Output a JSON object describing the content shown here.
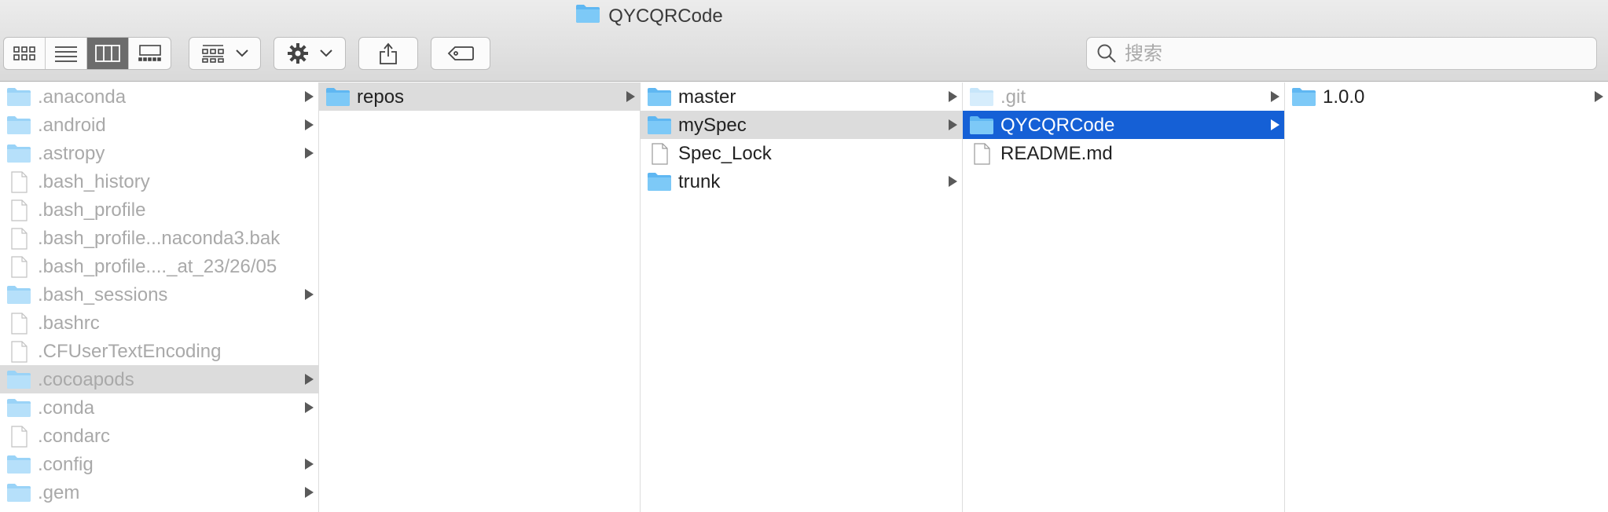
{
  "window": {
    "title": "QYCQRCode"
  },
  "toolbar": {
    "view_buttons": [
      "icon-view-icon",
      "list-view-icon",
      "column-view-icon",
      "gallery-view-icon"
    ],
    "active_view": "column-view-icon",
    "search_placeholder": "搜索"
  },
  "colors": {
    "selection_blue": "#1560d6",
    "selection_gray": "#dcdcdc",
    "folder_blue": "#5fb7f2"
  },
  "columns": [
    {
      "items": [
        {
          "name": ".anaconda",
          "kind": "folder",
          "has_children": true
        },
        {
          "name": ".android",
          "kind": "folder",
          "has_children": true
        },
        {
          "name": ".astropy",
          "kind": "folder",
          "has_children": true
        },
        {
          "name": ".bash_history",
          "kind": "file",
          "has_children": false
        },
        {
          "name": ".bash_profile",
          "kind": "file",
          "has_children": false
        },
        {
          "name": ".bash_profile...naconda3.bak",
          "kind": "file",
          "has_children": false
        },
        {
          "name": ".bash_profile...._at_23/26/05",
          "kind": "file",
          "has_children": false
        },
        {
          "name": ".bash_sessions",
          "kind": "folder",
          "has_children": true
        },
        {
          "name": ".bashrc",
          "kind": "file",
          "has_children": false
        },
        {
          "name": ".CFUserTextEncoding",
          "kind": "file",
          "has_children": false
        },
        {
          "name": ".cocoapods",
          "kind": "folder",
          "has_children": true,
          "selected": "gray"
        },
        {
          "name": ".conda",
          "kind": "folder",
          "has_children": true
        },
        {
          "name": ".condarc",
          "kind": "file",
          "has_children": false
        },
        {
          "name": ".config",
          "kind": "folder",
          "has_children": true
        },
        {
          "name": ".gem",
          "kind": "folder",
          "has_children": true
        }
      ]
    },
    {
      "items": [
        {
          "name": "repos",
          "kind": "folder",
          "has_children": true,
          "selected": "gray"
        }
      ]
    },
    {
      "items": [
        {
          "name": "master",
          "kind": "folder",
          "has_children": true
        },
        {
          "name": "mySpec",
          "kind": "folder",
          "has_children": true,
          "selected": "gray"
        },
        {
          "name": "Spec_Lock",
          "kind": "file",
          "has_children": false
        },
        {
          "name": "trunk",
          "kind": "folder",
          "has_children": true
        }
      ]
    },
    {
      "items": [
        {
          "name": ".git",
          "kind": "folder",
          "has_children": true,
          "hidden": true
        },
        {
          "name": "QYCQRCode",
          "kind": "folder",
          "has_children": true,
          "selected": "blue"
        },
        {
          "name": "README.md",
          "kind": "file",
          "has_children": false
        }
      ]
    },
    {
      "items": [
        {
          "name": "1.0.0",
          "kind": "folder",
          "has_children": true
        }
      ]
    }
  ]
}
